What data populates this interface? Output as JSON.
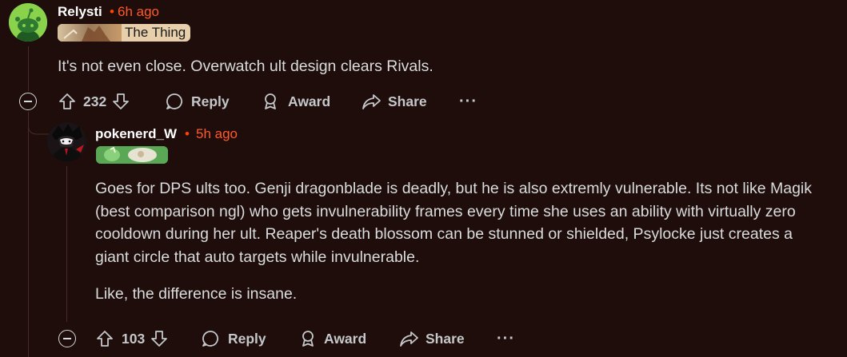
{
  "comment1": {
    "username": "Relysti",
    "time": "6h ago",
    "flair_text": "The Thing",
    "body": "It's not even close. Overwatch ult design clears Rivals.",
    "votes": "232",
    "actions": {
      "reply": "Reply",
      "award": "Award",
      "share": "Share",
      "more": "···"
    }
  },
  "comment2": {
    "username": "pokenerd_W",
    "time": "5h ago",
    "paragraphs": [
      "Goes for DPS ults too. Genji dragonblade is deadly, but he is also extremly vulnerable. Its not like Magik (best comparison ngl) who gets invulnerability frames every time she uses an ability with virtually zero cooldown during her ult. Reaper's death blossom can be stunned or shielded, Psylocke just creates a giant circle that auto targets while invulnerable.",
      "Like, the difference is insane."
    ],
    "votes": "103",
    "actions": {
      "reply": "Reply",
      "award": "Award",
      "share": "Share",
      "more": "···"
    }
  },
  "colors": {
    "background": "#1e0d0a",
    "accent_time": "#ff5a2a",
    "text": "#d7dadc",
    "thread_line": "#4a2a22"
  }
}
